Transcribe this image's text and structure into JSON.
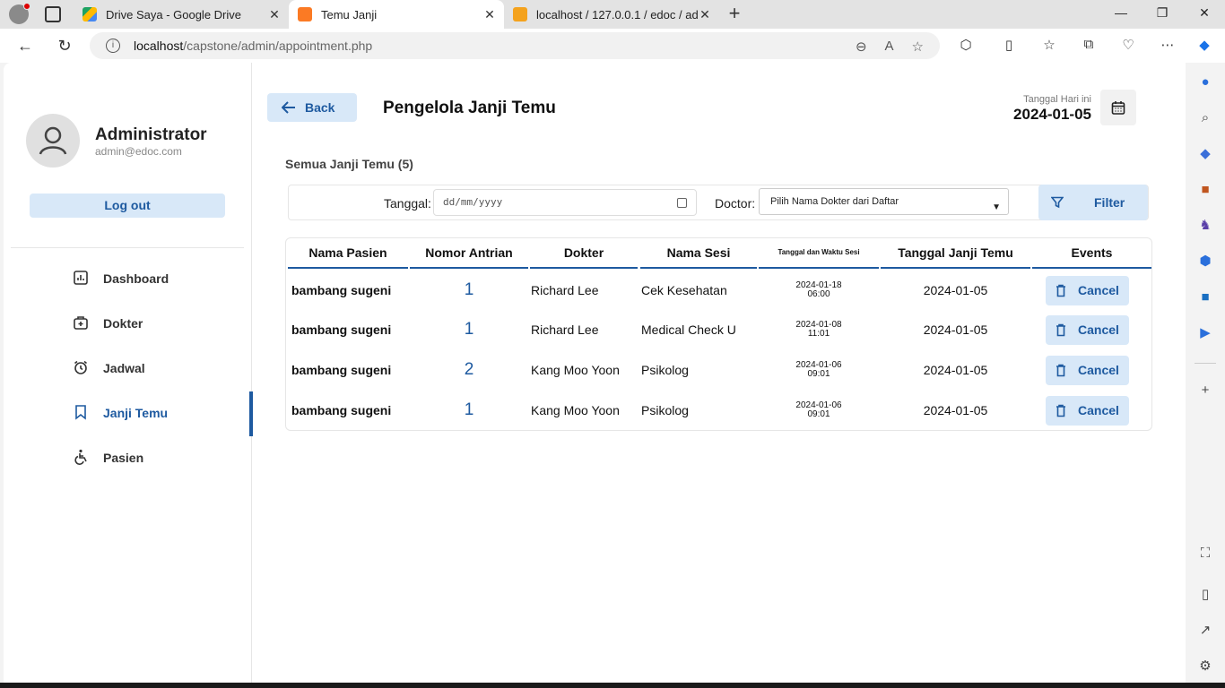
{
  "browser": {
    "tabs": [
      {
        "title": "Drive Saya - Google Drive"
      },
      {
        "title": "Temu Janji"
      },
      {
        "title": "localhost / 127.0.0.1 / edoc / adm"
      }
    ],
    "url_host": "localhost",
    "url_path": "/capstone/admin/appointment.php"
  },
  "sidebar": {
    "admin_name": "Administrator",
    "admin_email": "admin@edoc.com",
    "logout_label": "Log out",
    "items": [
      {
        "label": "Dashboard",
        "icon": "dashboard-icon"
      },
      {
        "label": "Dokter",
        "icon": "doctor-bag-icon"
      },
      {
        "label": "Jadwal",
        "icon": "alarm-clock-icon"
      },
      {
        "label": "Janji Temu",
        "icon": "bookmark-icon",
        "active": true
      },
      {
        "label": "Pasien",
        "icon": "wheelchair-icon"
      }
    ]
  },
  "header": {
    "back_label": "Back",
    "title": "Pengelola Janji Temu",
    "date_label": "Tanggal Hari ini",
    "date_value": "2024-01-05"
  },
  "section_title": "Semua Janji Temu (5)",
  "filter": {
    "date_label": "Tanggal:",
    "date_placeholder": "dd/mm/yyyy",
    "doctor_label": "Doctor:",
    "doctor_selected": "Pilih Nama Dokter dari Daftar",
    "button_label": "Filter"
  },
  "table": {
    "headers": [
      "Nama Pasien",
      "Nomor Antrian",
      "Dokter",
      "Nama Sesi",
      "Tanggal dan Waktu Sesi",
      "Tanggal Janji Temu",
      "Events"
    ],
    "rows": [
      {
        "pasien": "bambang sugeni",
        "antrian": "1",
        "dokter": "Richard Lee",
        "sesi": "Cek Kesehatan",
        "sesi_tanggal": "2024-01-18",
        "sesi_waktu": "06:00",
        "tanggal": "2024-01-05",
        "action": "Cancel"
      },
      {
        "pasien": "bambang sugeni",
        "antrian": "1",
        "dokter": "Richard Lee",
        "sesi": "Medical Check U",
        "sesi_tanggal": "2024-01-08",
        "sesi_waktu": "11:01",
        "tanggal": "2024-01-05",
        "action": "Cancel"
      },
      {
        "pasien": "bambang sugeni",
        "antrian": "2",
        "dokter": "Kang Moo Yoon",
        "sesi": "Psikolog",
        "sesi_tanggal": "2024-01-06",
        "sesi_waktu": "09:01",
        "tanggal": "2024-01-05",
        "action": "Cancel"
      },
      {
        "pasien": "bambang sugeni",
        "antrian": "1",
        "dokter": "Kang Moo Yoon",
        "sesi": "Psikolog",
        "sesi_tanggal": "2024-01-06",
        "sesi_waktu": "09:01",
        "tanggal": "2024-01-05",
        "action": "Cancel"
      }
    ]
  },
  "colors": {
    "accent": "#1e5aa0",
    "button_bg": "#d8e8f8"
  }
}
